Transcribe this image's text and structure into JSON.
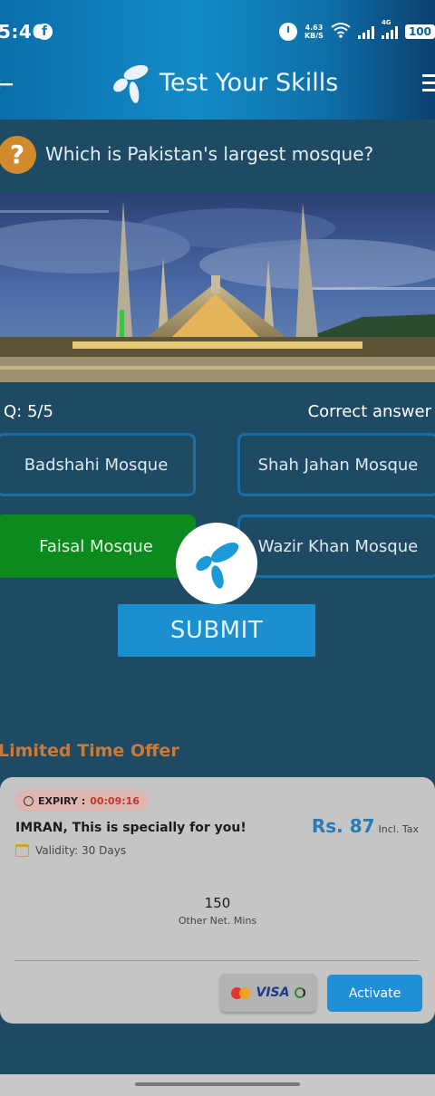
{
  "status_bar": {
    "time": "5:46",
    "social_icon": "f",
    "speed_value": "4.63",
    "speed_unit": "KB/S",
    "network_tag": "4G",
    "battery": "100",
    "icons": [
      "facebook-icon",
      "alarm-icon",
      "wifi-icon",
      "signal-icon",
      "battery-icon"
    ]
  },
  "header": {
    "title": "Test Your Skills",
    "back_icon": "arrow-left-icon",
    "menu_icon": "hamburger-menu-icon",
    "logo_icon": "brand-logo-icon"
  },
  "question": {
    "icon_glyph": "?",
    "text": "Which is Pakistan's largest mosque?",
    "counter": "Q: 5/5",
    "result": "Correct answer"
  },
  "options": [
    {
      "label": "Badshahi Mosque",
      "selected": false
    },
    {
      "label": "Shah Jahan Mosque",
      "selected": false
    },
    {
      "label": "Faisal Mosque",
      "selected": true
    },
    {
      "label": "Wazir Khan Mosque",
      "selected": false
    }
  ],
  "submit_label": "SUBMIT",
  "offer": {
    "section_title": "Limited Time Offer",
    "expiry_label": "EXPIRY :",
    "expiry_time": "00:09:16",
    "greeting": "IMRAN, This is specially for you!",
    "price": "Rs. 87",
    "price_note": "Incl. Tax",
    "validity": "Validity: 30 Days",
    "minutes_value": "150",
    "minutes_label": "Other Net. Mins",
    "payment_visa": "VISA",
    "activate_label": "Activate"
  },
  "colors": {
    "background": "#1f4a63",
    "header_blue": "#138bc6",
    "selected_green": "#0d8a1e",
    "accent_orange": "#c97a39",
    "submit_blue": "#1b8fd0"
  }
}
